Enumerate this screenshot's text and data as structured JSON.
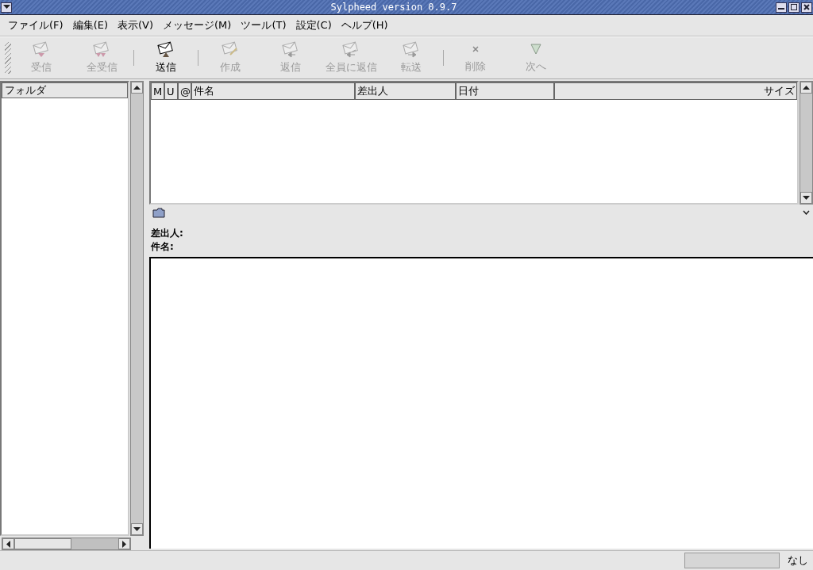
{
  "window": {
    "title": "Sylpheed version 0.9.7"
  },
  "menu": [
    "ファイル(F)",
    "編集(E)",
    "表示(V)",
    "メッセージ(M)",
    "ツール(T)",
    "設定(C)",
    "ヘルプ(H)"
  ],
  "toolbar": {
    "groups": [
      {
        "buttons": [
          {
            "kind": "receive",
            "label": "受信",
            "disabled": true
          },
          {
            "kind": "receive-all",
            "label": "全受信",
            "disabled": true
          }
        ]
      },
      {
        "buttons": [
          {
            "kind": "send",
            "label": "送信",
            "disabled": false
          }
        ]
      },
      {
        "buttons": [
          {
            "kind": "compose",
            "label": "作成",
            "disabled": true
          },
          {
            "kind": "reply",
            "label": "返信",
            "disabled": true
          },
          {
            "kind": "reply-all",
            "label": "全員に返信",
            "disabled": true
          },
          {
            "kind": "forward",
            "label": "転送",
            "disabled": true
          }
        ]
      },
      {
        "buttons": [
          {
            "kind": "delete",
            "label": "削除",
            "disabled": true
          },
          {
            "kind": "next",
            "label": "次へ",
            "disabled": true
          }
        ]
      }
    ]
  },
  "folder_list": {
    "header": "フォルダ"
  },
  "message_list": {
    "columns": [
      "M",
      "U",
      "@",
      "件名",
      "差出人",
      "日付",
      "サイズ"
    ]
  },
  "message_header": {
    "from_label": "差出人:",
    "subject_label": "件名:"
  },
  "status_bar": {
    "progress": {
      "level": 0
    },
    "text": "なし"
  }
}
